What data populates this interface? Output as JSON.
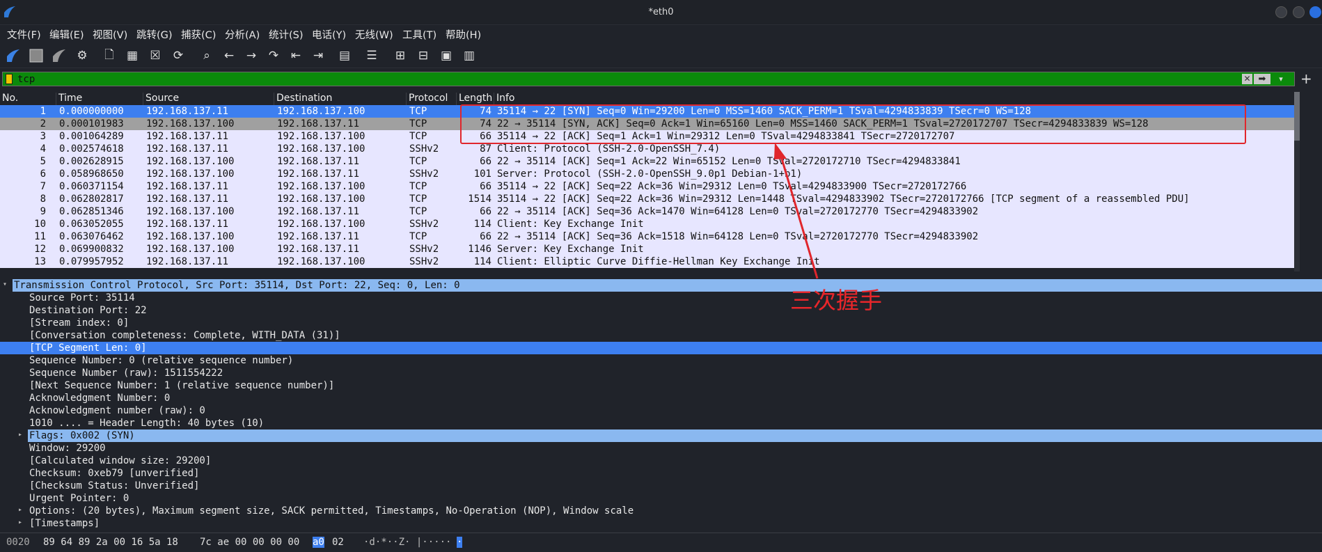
{
  "window": {
    "title": "*eth0"
  },
  "menu": [
    "文件(F)",
    "编辑(E)",
    "视图(V)",
    "跳转(G)",
    "捕获(C)",
    "分析(A)",
    "统计(S)",
    "电话(Y)",
    "无线(W)",
    "工具(T)",
    "帮助(H)"
  ],
  "toolbar_icons": [
    "shark-fin-start-icon",
    "stop-square-icon",
    "restart-fin-icon",
    "options-gear-icon",
    "open-file-icon",
    "save-file-icon",
    "close-file-icon",
    "reload-icon",
    "find-search-icon",
    "back-arrow-icon",
    "forward-arrow-icon",
    "go-to-packet-icon",
    "first-packet-icon",
    "last-packet-icon",
    "autoscroll-icon",
    "colorize-icon",
    "zoom-in-icon",
    "zoom-out-icon",
    "normal-size-icon",
    "resize-columns-icon"
  ],
  "filter": {
    "value": "tcp"
  },
  "columns": {
    "no": "No.",
    "time": "Time",
    "source": "Source",
    "destination": "Destination",
    "protocol": "Protocol",
    "length": "Length",
    "info": "Info"
  },
  "packets": [
    {
      "no": "1",
      "time": "0.000000000",
      "src": "192.168.137.11",
      "dst": "192.168.137.100",
      "proto": "TCP",
      "len": "74",
      "info": "35114 → 22 [SYN] Seq=0 Win=29200 Len=0 MSS=1460 SACK_PERM=1 TSval=4294833839 TSecr=0 WS=128"
    },
    {
      "no": "2",
      "time": "0.000101983",
      "src": "192.168.137.100",
      "dst": "192.168.137.11",
      "proto": "TCP",
      "len": "74",
      "info": "22 → 35114 [SYN, ACK] Seq=0 Ack=1 Win=65160 Len=0 MSS=1460 SACK_PERM=1 TSval=2720172707 TSecr=4294833839 WS=128"
    },
    {
      "no": "3",
      "time": "0.001064289",
      "src": "192.168.137.11",
      "dst": "192.168.137.100",
      "proto": "TCP",
      "len": "66",
      "info": "35114 → 22 [ACK] Seq=1 Ack=1 Win=29312 Len=0 TSval=4294833841 TSecr=2720172707"
    },
    {
      "no": "4",
      "time": "0.002574618",
      "src": "192.168.137.11",
      "dst": "192.168.137.100",
      "proto": "SSHv2",
      "len": "87",
      "info": "Client: Protocol (SSH-2.0-OpenSSH_7.4)"
    },
    {
      "no": "5",
      "time": "0.002628915",
      "src": "192.168.137.100",
      "dst": "192.168.137.11",
      "proto": "TCP",
      "len": "66",
      "info": "22 → 35114 [ACK] Seq=1 Ack=22 Win=65152 Len=0 TSval=2720172710 TSecr=4294833841"
    },
    {
      "no": "6",
      "time": "0.058968650",
      "src": "192.168.137.100",
      "dst": "192.168.137.11",
      "proto": "SSHv2",
      "len": "101",
      "info": "Server: Protocol (SSH-2.0-OpenSSH_9.0p1 Debian-1+b1)"
    },
    {
      "no": "7",
      "time": "0.060371154",
      "src": "192.168.137.11",
      "dst": "192.168.137.100",
      "proto": "TCP",
      "len": "66",
      "info": "35114 → 22 [ACK] Seq=22 Ack=36 Win=29312 Len=0 TSval=4294833900 TSecr=2720172766"
    },
    {
      "no": "8",
      "time": "0.062802817",
      "src": "192.168.137.11",
      "dst": "192.168.137.100",
      "proto": "TCP",
      "len": "1514",
      "info": "35114 → 22 [ACK] Seq=22 Ack=36 Win=29312 Len=1448 TSval=4294833902 TSecr=2720172766 [TCP segment of a reassembled PDU]"
    },
    {
      "no": "9",
      "time": "0.062851346",
      "src": "192.168.137.100",
      "dst": "192.168.137.11",
      "proto": "TCP",
      "len": "66",
      "info": "22 → 35114 [ACK] Seq=36 Ack=1470 Win=64128 Len=0 TSval=2720172770 TSecr=4294833902"
    },
    {
      "no": "10",
      "time": "0.063052055",
      "src": "192.168.137.11",
      "dst": "192.168.137.100",
      "proto": "SSHv2",
      "len": "114",
      "info": "Client: Key Exchange Init"
    },
    {
      "no": "11",
      "time": "0.063076462",
      "src": "192.168.137.100",
      "dst": "192.168.137.11",
      "proto": "TCP",
      "len": "66",
      "info": "22 → 35114 [ACK] Seq=36 Ack=1518 Win=64128 Len=0 TSval=2720172770 TSecr=4294833902"
    },
    {
      "no": "12",
      "time": "0.069900832",
      "src": "192.168.137.100",
      "dst": "192.168.137.11",
      "proto": "SSHv2",
      "len": "1146",
      "info": "Server: Key Exchange Init"
    },
    {
      "no": "13",
      "time": "0.079957952",
      "src": "192.168.137.11",
      "dst": "192.168.137.100",
      "proto": "SSHv2",
      "len": "114",
      "info": "Client: Elliptic Curve Diffie-Hellman Key Exchange Init"
    }
  ],
  "details": [
    {
      "text": "Transmission Control Protocol, Src Port: 35114, Dst Port: 22, Seq: 0, Len: 0",
      "indent": 0,
      "arrow": "down",
      "hl": "light"
    },
    {
      "text": "Source Port: 35114",
      "indent": 1
    },
    {
      "text": "Destination Port: 22",
      "indent": 1
    },
    {
      "text": "[Stream index: 0]",
      "indent": 1
    },
    {
      "text": "[Conversation completeness: Complete, WITH_DATA (31)]",
      "indent": 1
    },
    {
      "text": "[TCP Segment Len: 0]",
      "indent": 1,
      "hl": "blue"
    },
    {
      "text": "Sequence Number: 0    (relative sequence number)",
      "indent": 1
    },
    {
      "text": "Sequence Number (raw): 1511554222",
      "indent": 1
    },
    {
      "text": "[Next Sequence Number: 1    (relative sequence number)]",
      "indent": 1
    },
    {
      "text": "Acknowledgment Number: 0",
      "indent": 1
    },
    {
      "text": "Acknowledgment number (raw): 0",
      "indent": 1
    },
    {
      "text": "1010 .... = Header Length: 40 bytes (10)",
      "indent": 1
    },
    {
      "text": "Flags: 0x002 (SYN)",
      "indent": 1,
      "arrow": "right",
      "hl": "light"
    },
    {
      "text": "Window: 29200",
      "indent": 1
    },
    {
      "text": "[Calculated window size: 29200]",
      "indent": 1
    },
    {
      "text": "Checksum: 0xeb79 [unverified]",
      "indent": 1
    },
    {
      "text": "[Checksum Status: Unverified]",
      "indent": 1
    },
    {
      "text": "Urgent Pointer: 0",
      "indent": 1
    },
    {
      "text": "Options: (20 bytes), Maximum segment size, SACK permitted, Timestamps, No-Operation (NOP), Window scale",
      "indent": 1,
      "arrow": "right"
    },
    {
      "text": "[Timestamps]",
      "indent": 1,
      "arrow": "right"
    }
  ],
  "hex": {
    "offset": "0020",
    "bytes_a": "89 64 89 2a 00 16 5a 18",
    "bytes_b": "7c ae 00 00 00 00",
    "bytes_sel": "a0",
    "bytes_c": "02",
    "ascii": "·d·*··Z· |·····",
    "ascii_sel": "·"
  },
  "annotation": {
    "text": "三次握手",
    "color": "#e8262a"
  },
  "colors": {
    "selected": "#3d7ff0",
    "tcp_row": "#e7e6ff",
    "gray_row": "#a0a0a0",
    "filter_ok": "#0b8a0b",
    "detail_highlight": "#8ab8f0"
  }
}
